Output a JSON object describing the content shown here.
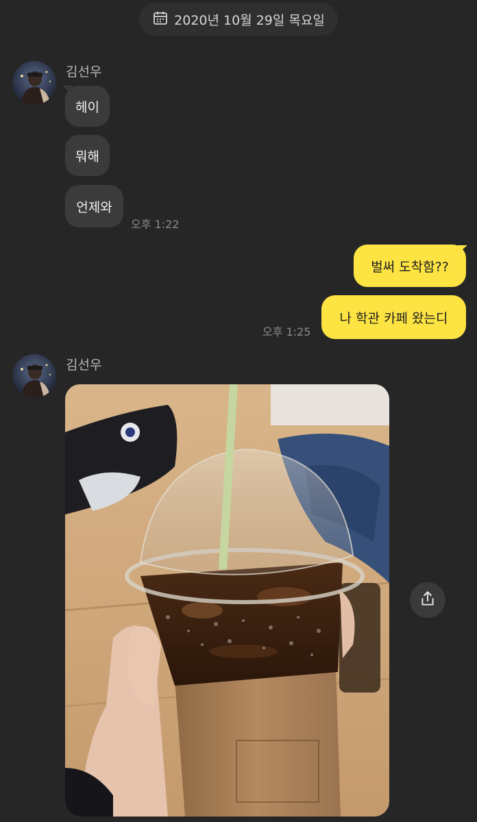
{
  "date_divider": {
    "text": "2020년 10월 29일 목요일",
    "icon": "calendar-icon"
  },
  "group1": {
    "sender": "김선우",
    "messages": [
      "헤이",
      "뭐해",
      "언제와"
    ],
    "time": "오후 1:22"
  },
  "group2": {
    "messages": [
      "벌써 도착함??",
      "나 학관 카페 왔는디"
    ],
    "time": "오후 1:25"
  },
  "group3": {
    "sender": "김선우",
    "photo_alt": "iced coffee photo",
    "share_icon": "share-icon"
  },
  "colors": {
    "background": "#262626",
    "incoming_bubble": "#3b3b3b",
    "outgoing_bubble": "#fde443"
  }
}
